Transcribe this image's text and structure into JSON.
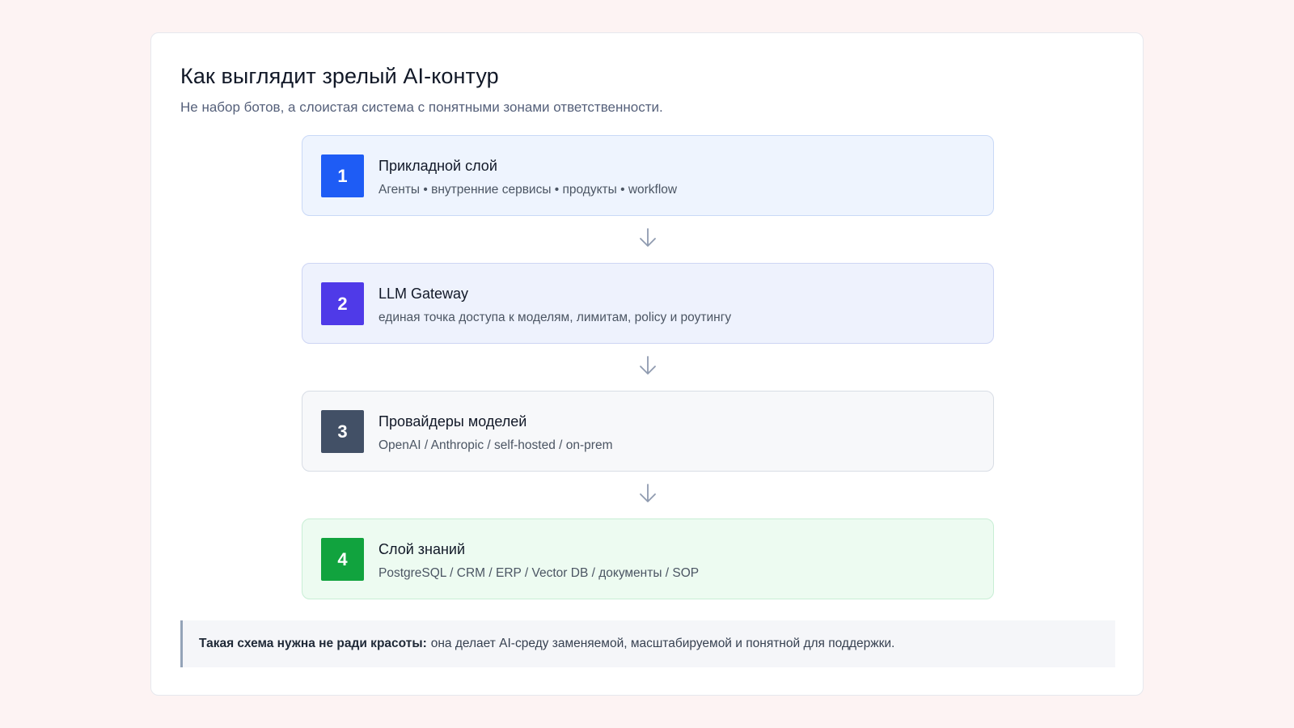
{
  "header": {
    "title": "Как выглядит зрелый AI-контур",
    "subtitle": "Не набор ботов, а слоистая система с понятными зонами ответственности."
  },
  "layers": [
    {
      "number": "1",
      "title": "Прикладной слой",
      "description": "Агенты • внутренние сервисы • продукты • workflow",
      "badge_color": "#1e5cf5",
      "bg_color": "#eef4fe",
      "border_color": "#c9d9f7"
    },
    {
      "number": "2",
      "title": "LLM Gateway",
      "description": "единая точка доступа к моделям, лимитам, policy и роутингу",
      "badge_color": "#4f3ae8",
      "bg_color": "#eef2fd",
      "border_color": "#cdd5f4"
    },
    {
      "number": "3",
      "title": "Провайдеры моделей",
      "description": "OpenAI / Anthropic / self-hosted / on-prem",
      "badge_color": "#425066",
      "bg_color": "#f7f8fa",
      "border_color": "#d8dde5"
    },
    {
      "number": "4",
      "title": "Слой знаний",
      "description": "PostgreSQL / CRM / ERP / Vector DB / документы / SOP",
      "badge_color": "#11a33e",
      "bg_color": "#edfbf1",
      "border_color": "#c8eed5"
    }
  ],
  "icons": {
    "connector": "arrow-down-icon",
    "arrow_color": "#8f9bb0"
  },
  "note": {
    "strong": "Такая схема нужна не ради красоты:",
    "text": "она делает AI-среду заменяемой, масштабируемой и понятной для поддержки."
  }
}
